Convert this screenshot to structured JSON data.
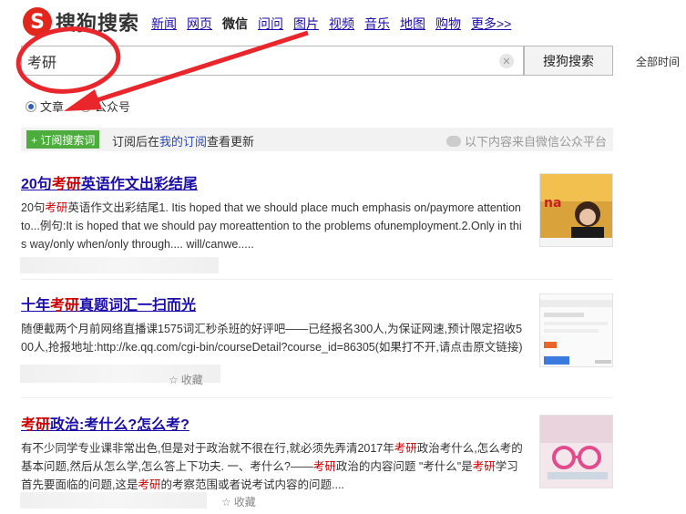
{
  "header": {
    "logo_mark": "S",
    "logo_text": "搜狗搜索",
    "nav": [
      {
        "label": "新闻",
        "active": false
      },
      {
        "label": "网页",
        "active": false
      },
      {
        "label": "微信",
        "active": true
      },
      {
        "label": "问问",
        "active": false
      },
      {
        "label": "图片",
        "active": false
      },
      {
        "label": "视频",
        "active": false
      },
      {
        "label": "音乐",
        "active": false
      },
      {
        "label": "地图",
        "active": false
      },
      {
        "label": "购物",
        "active": false
      },
      {
        "label": "更多>>",
        "active": false
      }
    ]
  },
  "search": {
    "query": "考研",
    "button_label": "搜狗搜索",
    "time_filter": "全部时间"
  },
  "filters": {
    "options": [
      {
        "label": "文章",
        "selected": true
      },
      {
        "label": "公众号",
        "selected": false
      }
    ]
  },
  "subscribe": {
    "button_label": "+ 订阅搜索词",
    "text_before": "订阅后在",
    "link": "我的订阅",
    "text_after": "查看更新",
    "source_note": "以下内容来自微信公众平台"
  },
  "results": [
    {
      "title_hl": "20句考研",
      "title_rest": "英语作文出彩结尾",
      "snippet": "20句考研英语作文出彩结尾1. Itis hoped that we should place much emphasis on/paymore attention to...例句:It is hoped that we should pay moreattention to the problems ofunemployment.2.Only in this way/only when/only through.... will/canwe.....",
      "fav_label": ""
    },
    {
      "title_hl": "十年考研",
      "title_rest": "真题词汇一扫而光",
      "snippet": "随便截两个月前网络直播课1575词汇秒杀班的好评吧——已经报名300人,为保证网速,预计限定招收500人,抢报地址:http://ke.qq.com/cgi-bin/courseDetail?course_id=86305(如果打不开,请点击原文链接)",
      "fav_label": "收藏"
    },
    {
      "title_hl": "考研",
      "title_rest": "政治:考什么?怎么考?",
      "snippet": "有不少同学专业课非常出色,但是对于政治就不很在行,就必须先弄清2017年考研政治考什么,怎么考的基本问题,然后从怎么学,怎么答上下功夫. 一、考什么?——考研政治的内容问题 \"考什么\"是考研学习首先要面临的问题,这是考研的考察范围或者说考试内容的问题....",
      "fav_label": "收藏"
    }
  ],
  "colors": {
    "link": "#1a0dab",
    "highlight": "#cc0000",
    "brand": "#e2261b",
    "subscribe_green": "#4cad3c",
    "annotation": "#e8262c"
  }
}
